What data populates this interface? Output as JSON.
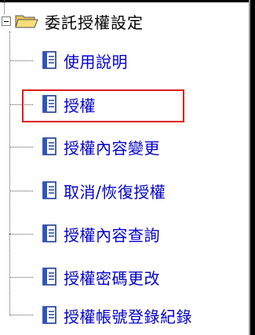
{
  "tree": {
    "root": {
      "label": "委託授權設定",
      "expander_icon": "minus-box-icon",
      "icon": "open-folder-icon"
    },
    "items": [
      {
        "id": "usage",
        "label": "使用說明",
        "icon": "document-icon"
      },
      {
        "id": "authorize",
        "label": "授權",
        "icon": "document-icon",
        "highlighted": true
      },
      {
        "id": "change",
        "label": "授權內容變更",
        "icon": "document-icon"
      },
      {
        "id": "cancel-restore",
        "label": "取消/恢復授權",
        "icon": "document-icon"
      },
      {
        "id": "query",
        "label": "授權內容查詢",
        "icon": "document-icon"
      },
      {
        "id": "change-password",
        "label": "授權密碼更改",
        "icon": "document-icon"
      },
      {
        "id": "login-log",
        "label": "授權帳號登錄紀錄",
        "icon": "document-icon"
      }
    ]
  },
  "colors": {
    "link": "#0000cc",
    "highlight_border": "#e0191b",
    "folder_yellow": "#f2c94c"
  }
}
